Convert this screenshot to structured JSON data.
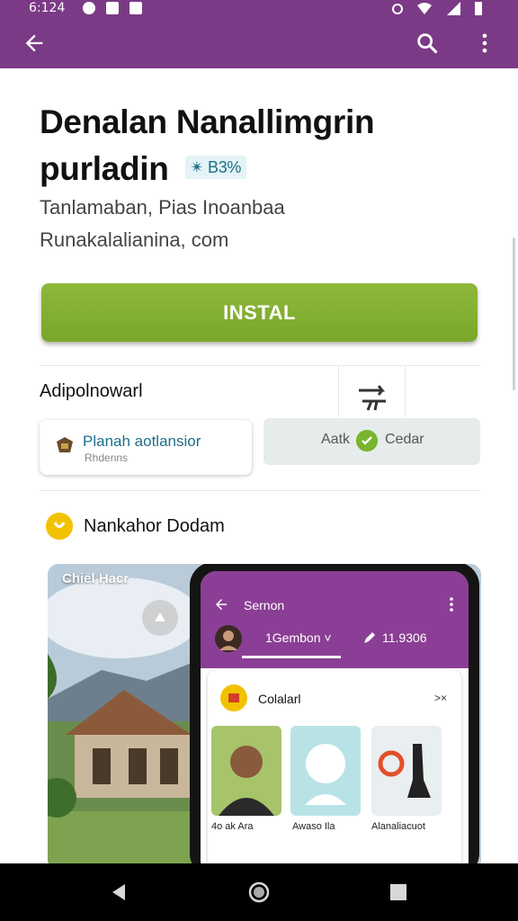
{
  "status_bar": {
    "time": "6:124"
  },
  "app_bar": {
    "back_icon": "arrow-left-icon",
    "search_icon": "search-icon",
    "more_icon": "more-vert-icon"
  },
  "app": {
    "title_line1": "Denalan Nanallimgrin",
    "title_line2": "purladin",
    "rating": "✴ B3%",
    "developer": "Tanlamaban, Pias Inoanbaa",
    "website": "Runakalalianina, com"
  },
  "install_button": {
    "label": "INSTAL"
  },
  "related": {
    "heading": "Adipolnowarl",
    "link_card": {
      "title": "Planah aotlansior",
      "subtitle": "Rhdenns"
    },
    "gray_card": {
      "left_text": "Aatk",
      "right_text": "Cedar"
    }
  },
  "section": {
    "title": "Nankahor Dodam"
  },
  "screenshot": {
    "badge": "Chiel Hacr",
    "phone": {
      "title": "Sernon",
      "tab_left": "1Gembon ˅",
      "tab_right": "11.9306",
      "card_title": "Colalarl",
      "card_close": ">×",
      "captions": [
        "4o ak Ara",
        "Awaso Ila",
        "Alanaliacuot"
      ]
    }
  },
  "colors": {
    "brand_purple": "#7b3a86",
    "install_green": "#86b133"
  }
}
